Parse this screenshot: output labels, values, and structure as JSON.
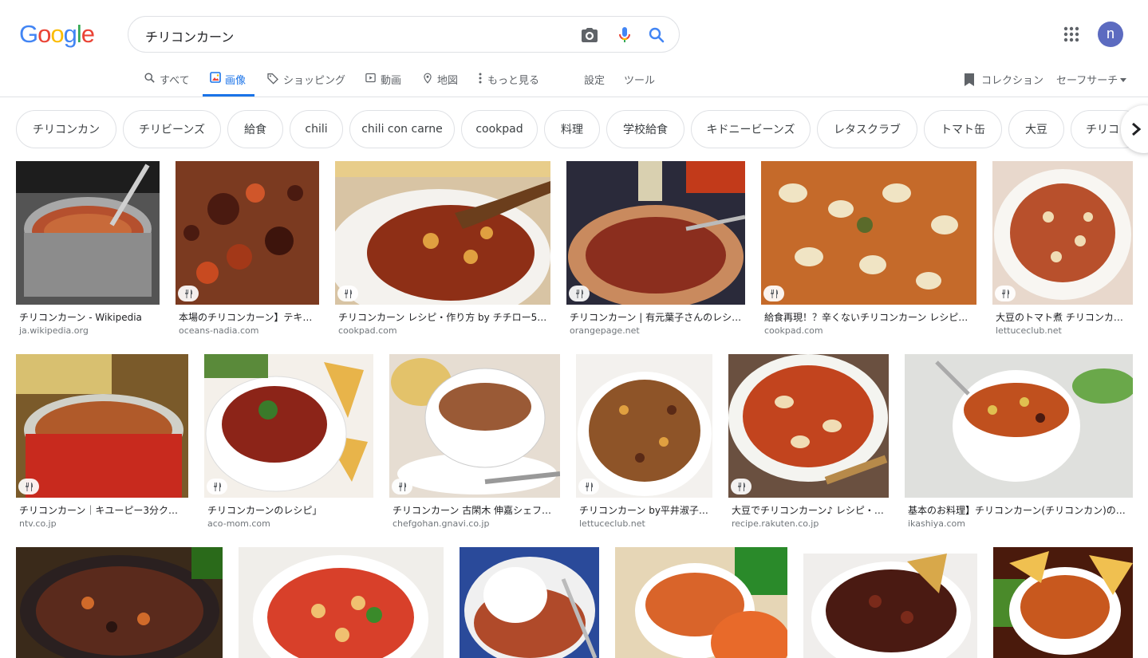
{
  "search": {
    "query": "チリコンカーン"
  },
  "account": {
    "initial": "n"
  },
  "nav": {
    "tabs": [
      {
        "label": "すべて",
        "icon": "search-icon"
      },
      {
        "label": "画像",
        "icon": "image-icon",
        "active": true
      },
      {
        "label": "ショッピング",
        "icon": "tag-icon"
      },
      {
        "label": "動画",
        "icon": "play-icon"
      },
      {
        "label": "地図",
        "icon": "map-pin-icon"
      },
      {
        "label": "もっと見る",
        "icon": "more-vert-icon"
      }
    ],
    "settings": "設定",
    "tools": "ツール",
    "collection": "コレクション",
    "safesearch": "セーフサーチ"
  },
  "chips": [
    "チリコンカン",
    "チリビーンズ",
    "給食",
    "chili",
    "chili con carne",
    "cookpad",
    "料理",
    "学校給食",
    "キドニービーンズ",
    "レタスクラブ",
    "トマト缶",
    "大豆",
    "チリコ"
  ],
  "results": {
    "row1": [
      {
        "title": "チリコンカーン - Wikipedia",
        "domain": "ja.wikipedia.org",
        "color": "#7a5a3c"
      },
      {
        "title": "本場のチリコンカーン】テキ…",
        "domain": "oceans-nadia.com",
        "color": "#8a3b1f"
      },
      {
        "title": "チリコンカーン レシピ・作り方 by チチロー5…",
        "domain": "cookpad.com",
        "color": "#9b3a1a"
      },
      {
        "title": "チリコンカーン | 有元葉子さんのレシ…",
        "domain": "orangepage.net",
        "color": "#8b2e1e"
      },
      {
        "title": "給食再現！？辛くないチリコンカーン レシピ…",
        "domain": "cookpad.com",
        "color": "#c0702a"
      },
      {
        "title": "大豆のトマト煮 チリコンカー…",
        "domain": "lettuceclub.net",
        "color": "#b85a34"
      }
    ],
    "row2": [
      {
        "title": "チリコンカーン｜キユーピー3分クッ…",
        "domain": "ntv.co.jp",
        "color": "#a7442a"
      },
      {
        "title": "チリコンカーンのレシピ」",
        "domain": "aco-mom.com",
        "color": "#9c2f1d"
      },
      {
        "title": "チリコンカーン 古閑木 伸嘉シェフ…",
        "domain": "chefgohan.gnavi.co.jp",
        "color": "#a36a46"
      },
      {
        "title": "チリコンカーン by平井淑子…",
        "domain": "lettuceclub.net",
        "color": "#9a5a2e"
      },
      {
        "title": "大豆でチリコンカーン♪ レシピ・…",
        "domain": "recipe.rakuten.co.jp",
        "color": "#c2441e"
      },
      {
        "title": "基本のお料理】チリコンカーン(チリコンカン)の…",
        "domain": "ikashiya.com",
        "color": "#c06a3a"
      }
    ],
    "row3": [
      {
        "color": "#5a2a1c"
      },
      {
        "color": "#d8402a"
      },
      {
        "color": "#b04a2a"
      },
      {
        "color": "#d9642a"
      },
      {
        "color": "#4a1a12"
      },
      {
        "color": "#c8581e"
      }
    ]
  },
  "colors": {
    "accent": "#1a73e8",
    "avatar": "#5c6bc0"
  }
}
